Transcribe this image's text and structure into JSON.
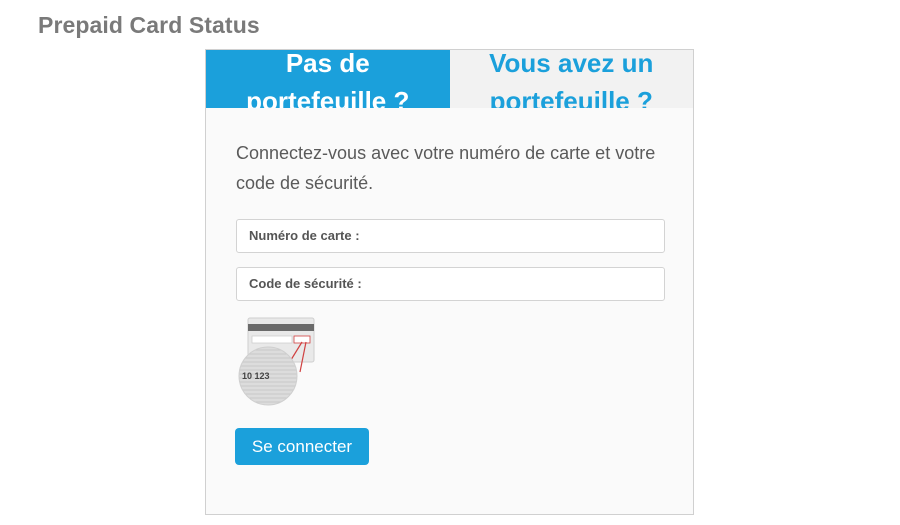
{
  "page": {
    "title": "Prepaid Card Status"
  },
  "tabs": [
    {
      "line1": "Pas de",
      "line2": "portefeuille ?",
      "active": true
    },
    {
      "line1": "Vous avez un",
      "line2": "portefeuille ?",
      "active": false
    }
  ],
  "form": {
    "intro": "Connectez-vous avec votre numéro de carte et votre code de sécurité.",
    "card_number_label": "Numéro de carte :",
    "security_code_label": "Code de sécurité :",
    "illustration": {
      "icon": "card-security-code-icon",
      "sample_code_text": "10 123"
    },
    "submit_label": "Se connecter"
  },
  "colors": {
    "accent": "#1ba0db",
    "title": "#7a7a7a",
    "text": "#5a5a5a"
  }
}
